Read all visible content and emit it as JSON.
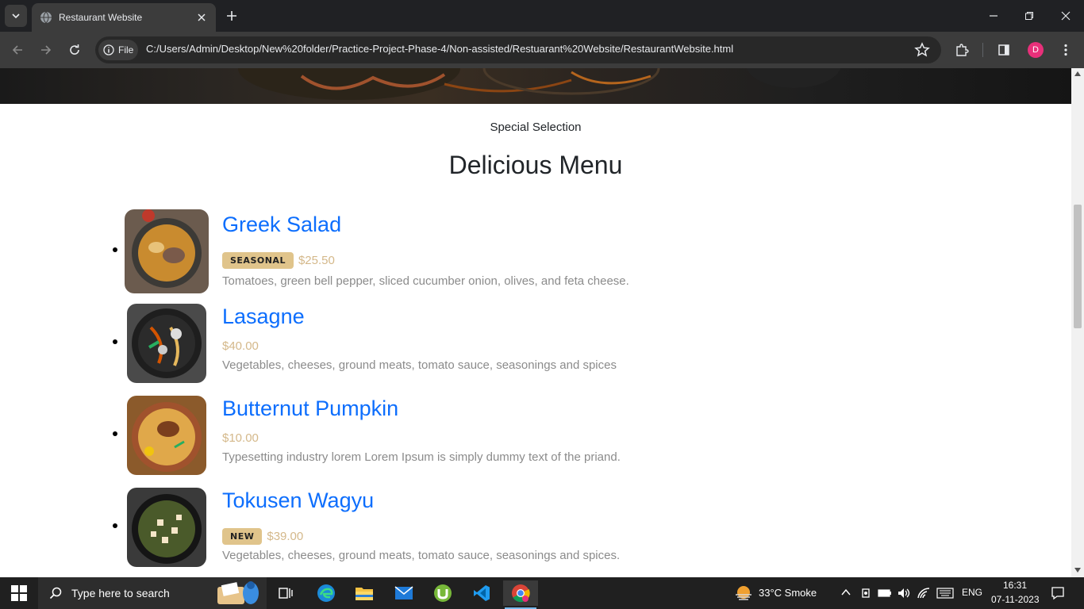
{
  "browser": {
    "tab_title": "Restaurant Website",
    "chip_label": "File",
    "url": "C:/Users/Admin/Desktop/New%20folder/Practice-Project-Phase-4/Non-assisted/Restuarant%20Website/RestaurantWebsite.html",
    "profile_initial": "D"
  },
  "page": {
    "subtitle": "Special Selection",
    "heading": "Delicious Menu",
    "items": [
      {
        "name": "Greek Salad",
        "badge": "SEASONAL",
        "price": "$25.50",
        "description": "Tomatoes, green bell pepper, sliced cucumber onion, olives, and feta cheese."
      },
      {
        "name": "Lasagne",
        "badge": "",
        "price": "$40.00",
        "description": "Vegetables, cheeses, ground meats, tomato sauce, seasonings and spices"
      },
      {
        "name": "Butternut Pumpkin",
        "badge": "",
        "price": "$10.00",
        "description": "Typesetting industry lorem Lorem Ipsum is simply dummy text of the priand."
      },
      {
        "name": "Tokusen Wagyu",
        "badge": "NEW",
        "price": "$39.00",
        "description": "Vegetables, cheeses, ground meats, tomato sauce, seasonings and spices."
      }
    ]
  },
  "taskbar": {
    "search_placeholder": "Type here to search",
    "weather": "33°C  Smoke",
    "language": "ENG",
    "time": "16:31",
    "date": "07-11-2023"
  },
  "colors": {
    "accent_link": "#0d6efd",
    "badge": "#e0c48b",
    "price": "#d4b88a"
  }
}
